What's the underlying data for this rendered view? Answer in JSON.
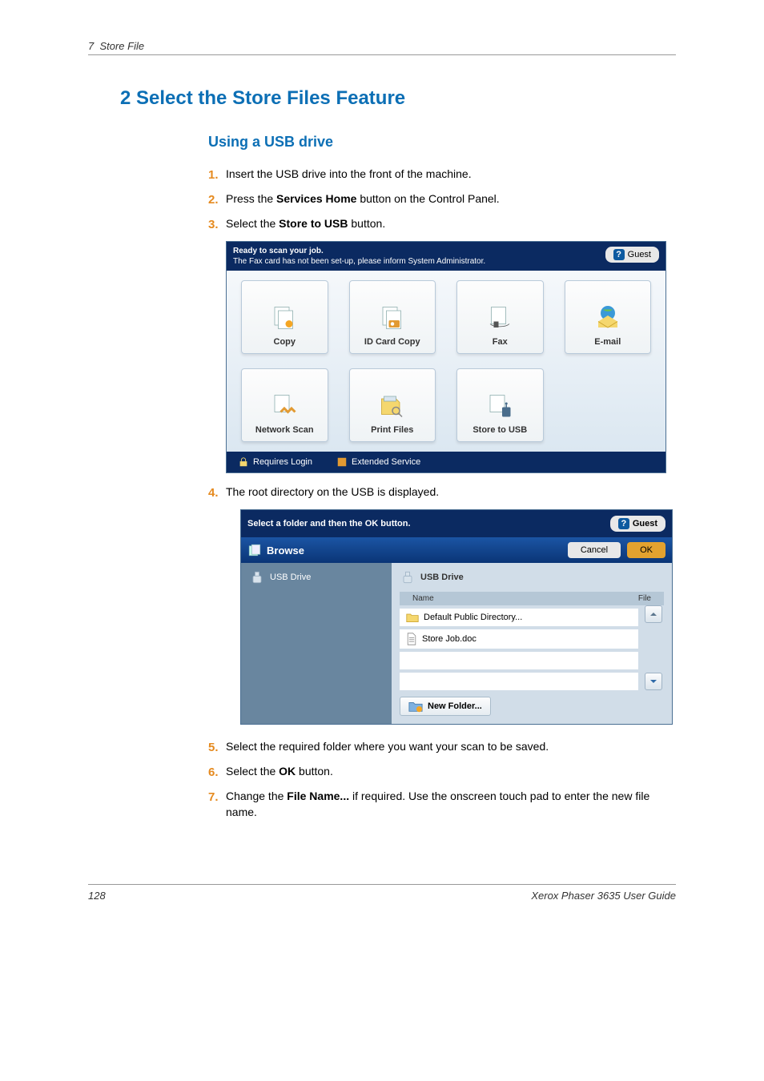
{
  "meta": {
    "chapter_number": "7",
    "chapter_title": "Store File",
    "page_number": "128",
    "guide_title": "Xerox Phaser 3635 User Guide"
  },
  "section": {
    "title": "2 Select the Store Files Feature",
    "sub_title": "Using a USB drive"
  },
  "steps": {
    "items": [
      {
        "num": "1.",
        "text_plain": "Insert the USB drive into the front of the machine."
      },
      {
        "num": "2.",
        "pre": "Press the ",
        "bold": "Services Home",
        "post": " button on the Control Panel."
      },
      {
        "num": "3.",
        "pre": "Select the ",
        "bold": "Store to USB",
        "post": " button."
      },
      {
        "num": "4.",
        "text_plain": "The root directory on the USB is displayed."
      },
      {
        "num": "5.",
        "text_plain": "Select the required folder where you want your scan to be saved."
      },
      {
        "num": "6.",
        "pre": "Select the ",
        "bold": "OK",
        "post": " button."
      },
      {
        "num": "7.",
        "pre": "Change the ",
        "bold": "File Name...",
        "post": " if required. Use the onscreen touch pad to enter the new file name."
      }
    ]
  },
  "screenshot1": {
    "status_title": "Ready to scan your job.",
    "status_line": "The Fax card has not been set-up, please inform System Administrator.",
    "guest_label": "Guest",
    "tiles": [
      {
        "label": "Copy"
      },
      {
        "label": "ID Card Copy"
      },
      {
        "label": "Fax"
      },
      {
        "label": "E-mail"
      },
      {
        "label": "Network Scan"
      },
      {
        "label": "Print Files"
      },
      {
        "label": "Store to USB"
      }
    ],
    "footer_items": [
      "Requires Login",
      "Extended Service"
    ]
  },
  "screenshot2": {
    "instruction": "Select a folder and then the OK button.",
    "guest_label": "Guest",
    "browse_label": "Browse",
    "cancel_label": "Cancel",
    "ok_label": "OK",
    "left_tree": "USB Drive",
    "drive_title": "USB Drive",
    "col_name": "Name",
    "col_file": "File",
    "rows": [
      {
        "label": "Default Public Directory..."
      },
      {
        "label": "Store Job.doc"
      }
    ],
    "new_folder": "New Folder..."
  }
}
